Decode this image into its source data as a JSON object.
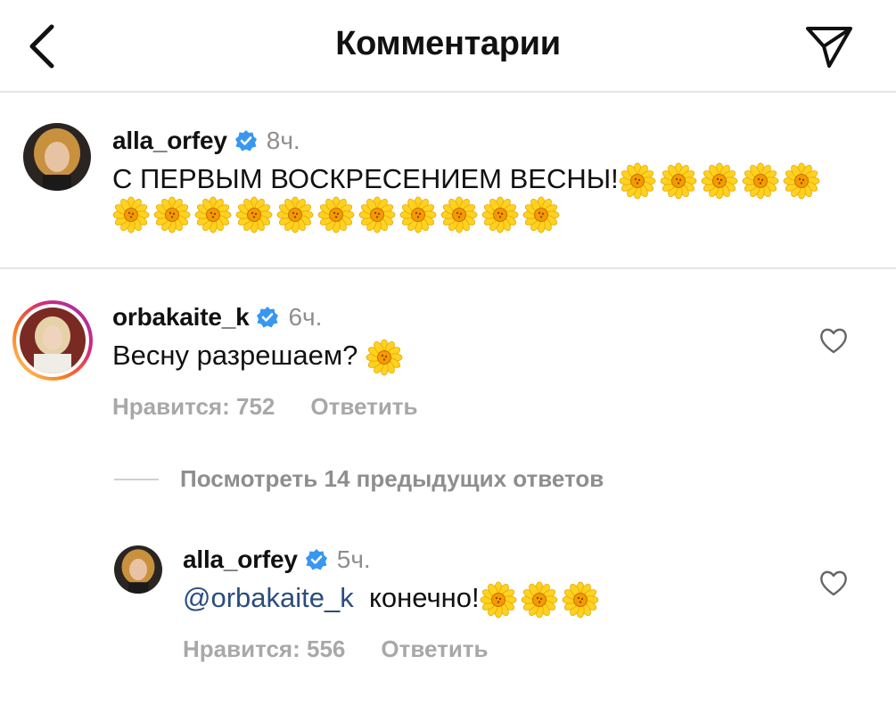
{
  "header": {
    "title": "Комментарии",
    "back_icon": "chevron-left-icon",
    "send_icon": "paper-plane-icon"
  },
  "caption": {
    "username": "alla_orfey",
    "time": "8ч.",
    "text": "С ПЕРВЫМ ВОСКРЕСЕНИЕМ ВЕСНЫ!",
    "flowers_line1": 5,
    "flowers_line2": 11
  },
  "comment": {
    "username": "orbakaite_k",
    "time": "6ч.",
    "text": "Весну разрешаем?",
    "flowers": 1,
    "likes": "Нравится: 752",
    "reply": "Ответить"
  },
  "view_replies": "Посмотреть 14 предыдущих ответов",
  "reply": {
    "username": "alla_orfey",
    "time": "5ч.",
    "mention": "@orbakaite_k",
    "text": "конечно!",
    "flowers": 3,
    "likes": "Нравится: 556",
    "reply": "Ответить"
  },
  "colors": {
    "verified": "#3897f0",
    "muted": "#8e8e8e",
    "mention": "#2b4d7e",
    "divider": "#e6e6e6"
  }
}
